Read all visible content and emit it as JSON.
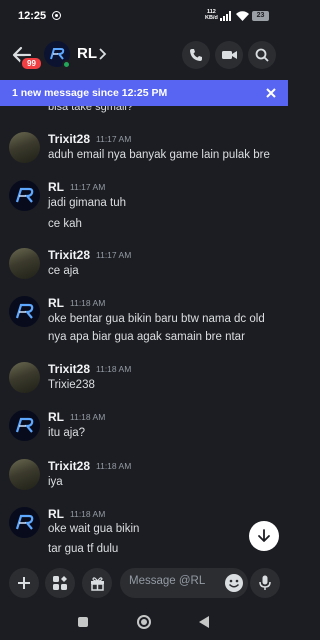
{
  "status": {
    "time": "12:25",
    "net_top": "112",
    "net_bottom": "KB/d",
    "battery": "23"
  },
  "header": {
    "channel_name": "RL",
    "unread_count": "99"
  },
  "banner": {
    "text": "1 new message since 12:25 PM"
  },
  "messages": {
    "partial_line": "bisa take sgmail?",
    "items": [
      {
        "author": "Trixit28",
        "time": "11:17 AM",
        "lines": [
          "aduh email nya banyak game lain pulak bre"
        ]
      },
      {
        "author": "RL",
        "time": "11:17 AM",
        "lines": [
          "jadi gimana tuh",
          "ce kah"
        ]
      },
      {
        "author": "Trixit28",
        "time": "11:17 AM",
        "lines": [
          "ce aja"
        ]
      },
      {
        "author": "RL",
        "time": "11:18 AM",
        "lines": [
          "oke bentar gua bikin baru btw nama dc old",
          "nya apa biar gua agak samain bre ntar"
        ]
      },
      {
        "author": "Trixit28",
        "time": "11:18 AM",
        "lines": [
          "Trixie238"
        ]
      },
      {
        "author": "RL",
        "time": "11:18 AM",
        "lines": [
          "itu aja?"
        ]
      },
      {
        "author": "Trixit28",
        "time": "11:18 AM",
        "lines": [
          "iya"
        ]
      },
      {
        "author": "RL",
        "time": "11:18 AM",
        "lines": [
          "oke wait gua bikin",
          "tar gua tf dulu"
        ]
      }
    ]
  },
  "composer": {
    "placeholder": "Message @RL"
  },
  "colors": {
    "accent": "#5865f2",
    "badge": "#f23f43",
    "online": "#23a55a",
    "background": "#1c1d22"
  }
}
